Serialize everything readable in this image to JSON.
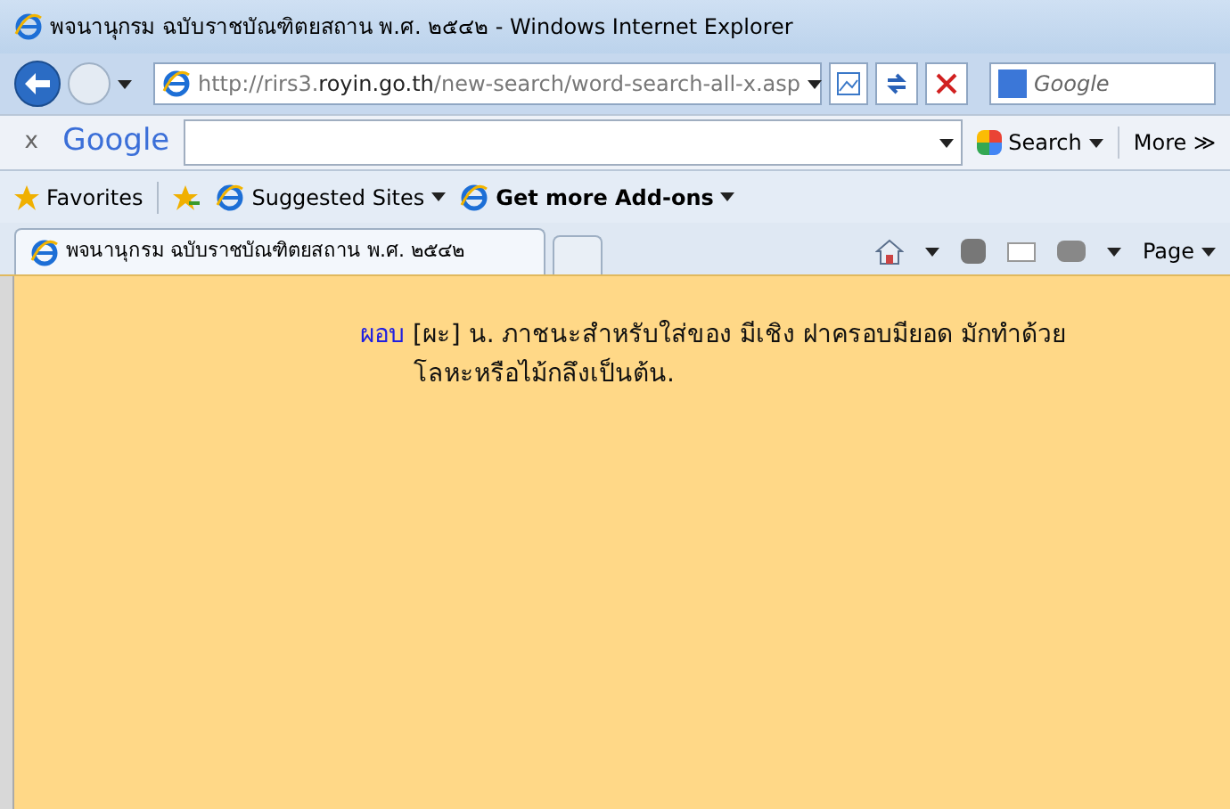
{
  "window": {
    "title": "พจนานุกรม ฉบับราชบัณฑิตยสถาน พ.ศ. ๒๕๔๒ - Windows Internet Explorer"
  },
  "address_bar": {
    "url_scheme": "http://rirs3.",
    "url_domain": "royin.go.th",
    "url_path": "/new-search/word-search-all-x.asp"
  },
  "search_box": {
    "placeholder": "Google"
  },
  "google_toolbar": {
    "close": "x",
    "logo": "Google",
    "search_button": "Search",
    "more_button": "More ≫"
  },
  "favorites_bar": {
    "favorites": "Favorites",
    "items": [
      {
        "label": "Suggested Sites",
        "bold": false
      },
      {
        "label": "Get more Add-ons",
        "bold": true
      }
    ]
  },
  "tabs": [
    {
      "label": "พจนานุกรม ฉบับราชบัณฑิตยสถาน พ.ศ. ๒๕๔๒",
      "selected": true
    }
  ],
  "command_bar": {
    "page": "Page"
  },
  "entry": {
    "headword": "ผอบ",
    "definition": "[ผะ] น. ภาชนะสำหรับใส่ของ มีเชิง ฝาครอบมียอด มักทำด้วยโลหะหรือไม้กลึงเป็นต้น."
  }
}
